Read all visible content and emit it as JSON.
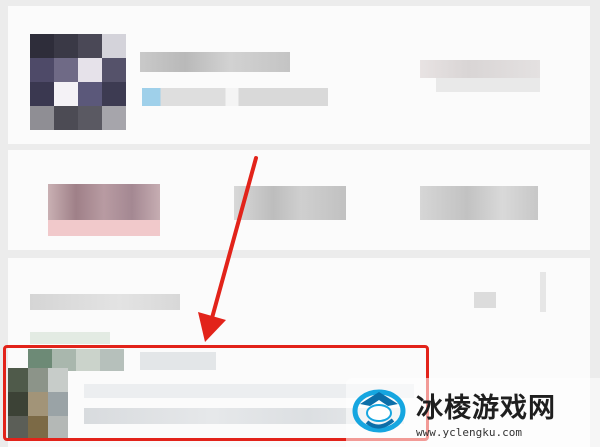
{
  "watermark": {
    "title": "冰棱游戏网",
    "url": "www.yclengku.com",
    "logo_icon": "ice-crystal-logo-icon"
  },
  "annotation": {
    "color": "#e2231a"
  }
}
